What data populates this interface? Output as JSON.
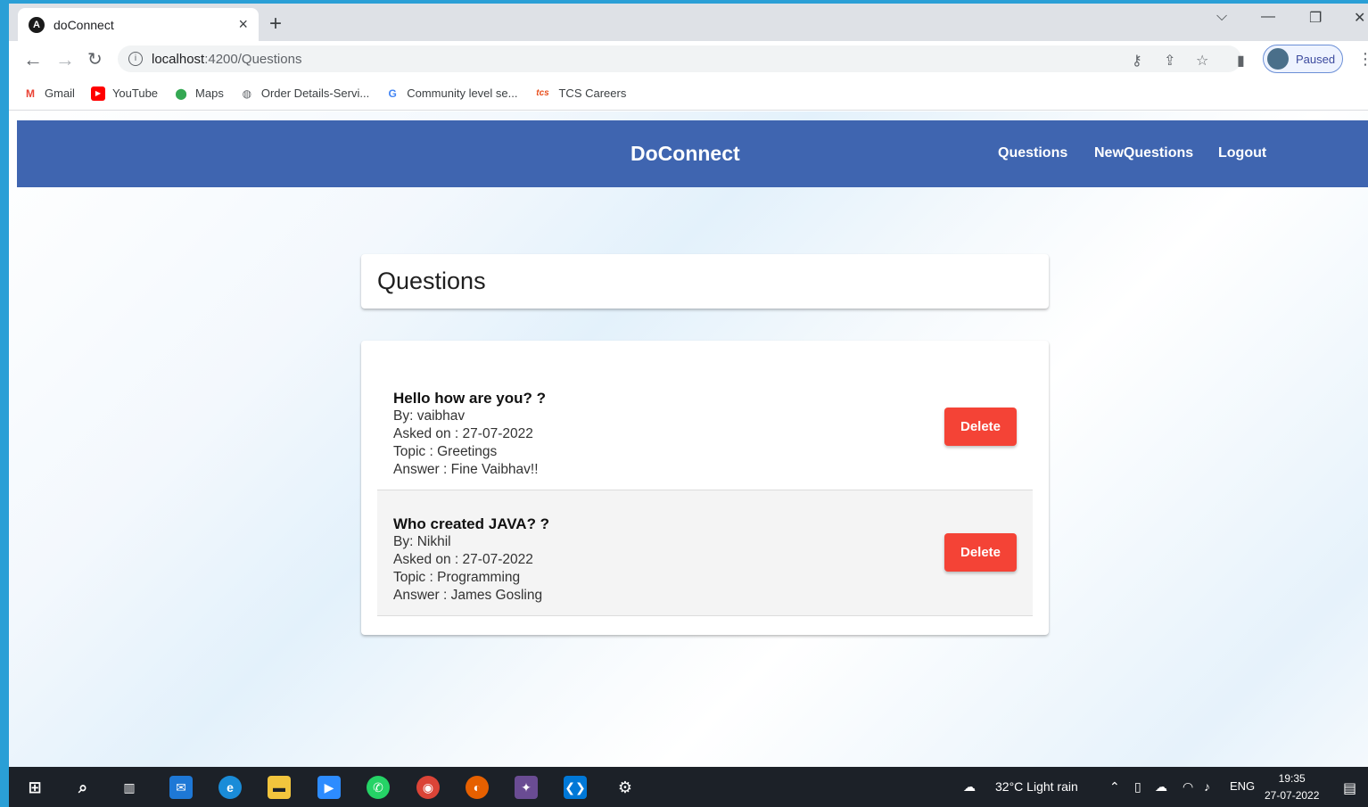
{
  "browser": {
    "tab_title": "doConnect",
    "tab_close": "×",
    "new_tab": "+",
    "url_host": "localhost",
    "url_path": ":4200/Questions",
    "profile_label": "Paused",
    "bookmarks": [
      {
        "label": "Gmail",
        "icon": "gmail-icon",
        "color": "#ea4335",
        "glyph": "M"
      },
      {
        "label": "YouTube",
        "icon": "youtube-icon",
        "color": "#ff0000",
        "glyph": "▶"
      },
      {
        "label": "Maps",
        "icon": "maps-icon",
        "color": "#34a853",
        "glyph": "⬤"
      },
      {
        "label": "Order Details-Servi...",
        "icon": "globe-icon",
        "color": "#5f6368",
        "glyph": "◍"
      },
      {
        "label": "Community level se...",
        "icon": "google-icon",
        "color": "#4285f4",
        "glyph": "G"
      },
      {
        "label": "TCS Careers",
        "icon": "tcs-icon",
        "color": "#e8501f",
        "glyph": "tcs"
      }
    ]
  },
  "app": {
    "brand": "DoConnect",
    "nav": [
      "Questions",
      "NewQuestions",
      "Logout"
    ],
    "page_title": "Questions",
    "questions": [
      {
        "title": "Hello how are you? ?",
        "by": "By: vaibhav",
        "asked": "Asked on : 27-07-2022",
        "topic": "Topic : Greetings",
        "answer": "Answer : Fine Vaibhav!!",
        "delete_label": "Delete"
      },
      {
        "title": "Who created JAVA? ?",
        "by": "By: Nikhil",
        "asked": "Asked on : 27-07-2022",
        "topic": "Topic : Programming",
        "answer": "Answer : James Gosling",
        "delete_label": "Delete"
      }
    ]
  },
  "taskbar": {
    "weather": "32°C  Light rain",
    "language": "ENG",
    "time": "19:35",
    "date": "27-07-2022"
  },
  "colors": {
    "appbar": "#3f65b0",
    "delete": "#f44336"
  }
}
